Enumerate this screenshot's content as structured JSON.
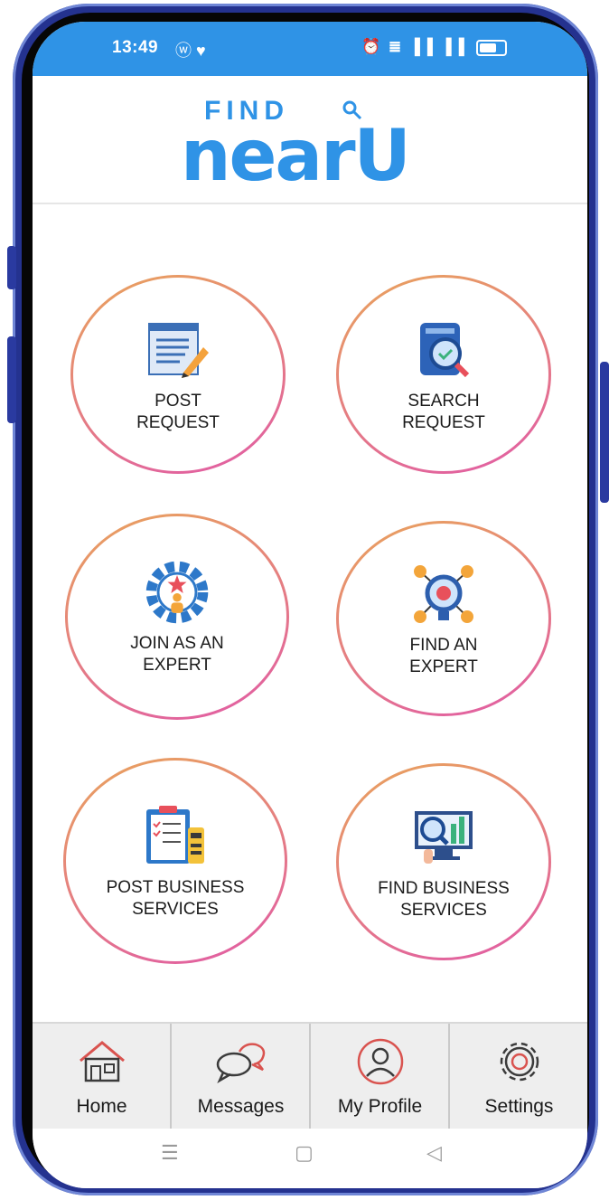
{
  "status_bar": {
    "time": "13:49",
    "left_icons": "ⓦ ♥",
    "right_icons": "⏰ ≣ ▐▐ ▐▐"
  },
  "logo": {
    "find": "FIND",
    "near": "nearU"
  },
  "tiles": [
    {
      "label_line1": "POST",
      "label_line2": "REQUEST",
      "icon": "post-request-icon"
    },
    {
      "label_line1": "SEARCH",
      "label_line2": "REQUEST",
      "icon": "search-request-icon"
    },
    {
      "label_line1": "JOIN AS AN",
      "label_line2": "EXPERT",
      "icon": "join-expert-icon"
    },
    {
      "label_line1": "FIND AN",
      "label_line2": "EXPERT",
      "icon": "find-expert-icon"
    },
    {
      "label_line1": "POST BUSINESS",
      "label_line2": "SERVICES",
      "icon": "post-business-icon"
    },
    {
      "label_line1": "FIND BUSINESS",
      "label_line2": "SERVICES",
      "icon": "find-business-icon"
    }
  ],
  "tabs": [
    {
      "label": "Home",
      "icon": "home-icon"
    },
    {
      "label": "Messages",
      "icon": "messages-icon"
    },
    {
      "label": "My Profile",
      "icon": "profile-icon"
    },
    {
      "label": "Settings",
      "icon": "settings-icon"
    }
  ],
  "nav": {
    "menu": "☰",
    "home": "▢",
    "back": "◁"
  },
  "colors": {
    "brand": "#2f93e6",
    "ring_start": "#e9a45b",
    "ring_end": "#e15aa7",
    "icon_accent": "#e86a5c"
  }
}
